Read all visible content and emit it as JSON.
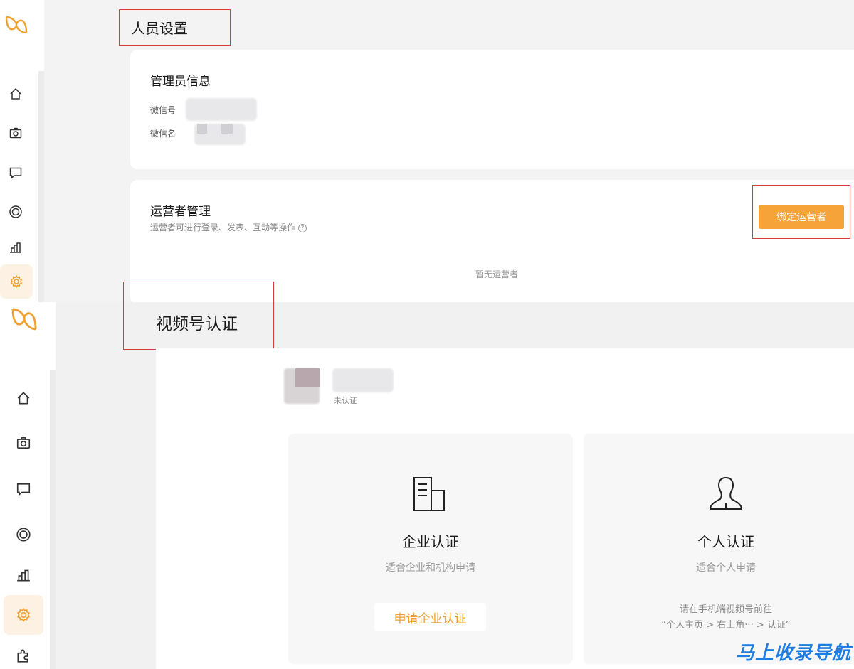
{
  "screen1": {
    "title": "人员设置",
    "admin_card": {
      "heading": "管理员信息",
      "wechat_id_label": "微信号",
      "wechat_name_label": "微信名"
    },
    "operator_card": {
      "heading": "运营者管理",
      "description": "运营者可进行登录、发表、互动等操作",
      "bind_button": "绑定运营者",
      "empty_text": "暂无运营者"
    }
  },
  "screen2": {
    "title": "视频号认证",
    "account_status": "未认证",
    "enterprise": {
      "title": "企业认证",
      "subtitle": "适合企业和机构申请",
      "button": "申请企业认证"
    },
    "personal": {
      "title": "个人认证",
      "subtitle": "适合个人申请",
      "note_line1": "请在手机端视频号前往",
      "note_line2": "“个人主页 > 右上角··· > 认证”"
    }
  },
  "sidebar_icons": [
    "logo-icon",
    "home-icon",
    "camera-icon",
    "comment-icon",
    "live-icon",
    "chart-icon",
    "settings-icon"
  ],
  "watermark": "马上收录导航",
  "colors": {
    "accent": "#f6a43a",
    "highlight_box": "#d93a3a",
    "watermark": "#1e7de0"
  }
}
